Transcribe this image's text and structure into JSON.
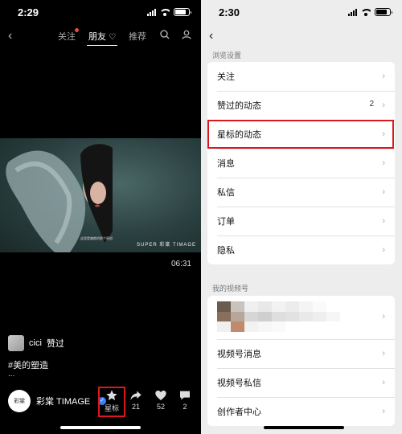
{
  "left_screen": {
    "status_time": "2:29",
    "tabs": [
      {
        "label": "关注",
        "has_dot": true
      },
      {
        "label": "朋友",
        "active": true
      },
      {
        "label": "推荐"
      }
    ],
    "video": {
      "duration": "06:31",
      "watermark": "SUPER 彩棠 TIMAGE",
      "subtitle": "这里是美颜的那个原创"
    },
    "liker": {
      "name": "cici",
      "action": "赞过"
    },
    "hashtag": "#美的塑造",
    "ellipsis": "...",
    "creator": {
      "name": "彩棠 TIMAGE",
      "avatar_text": "彩棠"
    },
    "actions": {
      "star_label": "星标",
      "share_count": "21",
      "like_count": "52",
      "comment_count": "2"
    }
  },
  "right_screen": {
    "status_time": "2:30",
    "section_browse": "浏览设置",
    "browse_items": [
      {
        "label": "关注"
      },
      {
        "label": "赞过的动态",
        "count": "2"
      },
      {
        "label": "星标的动态"
      },
      {
        "label": "消息"
      },
      {
        "label": "私信"
      },
      {
        "label": "订单"
      },
      {
        "label": "隐私"
      }
    ],
    "section_channel": "我的视频号",
    "channel_items": [
      {
        "label": "视频号消息"
      },
      {
        "label": "视频号私信"
      },
      {
        "label": "创作者中心"
      }
    ]
  },
  "colors": {
    "highlight": "#d9191f",
    "verified": "#3b82f6",
    "tab_dot": "#e94b3c"
  }
}
